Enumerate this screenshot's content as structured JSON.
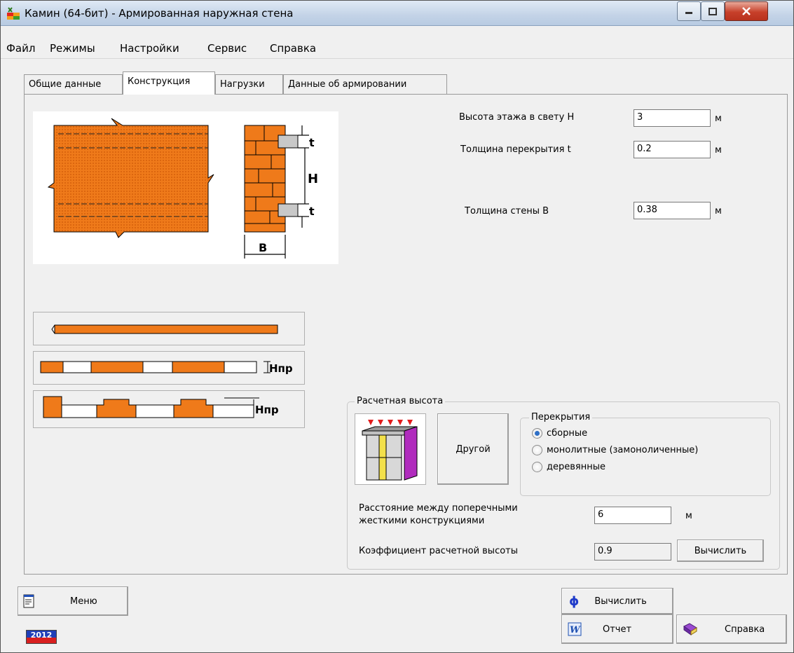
{
  "window": {
    "title": "Камин (64-бит) - Армированная наружная стена"
  },
  "menu": [
    "Файл",
    "Режимы",
    "Настройки",
    "Сервис",
    "Справка"
  ],
  "tabs": [
    "Общие данные",
    "Конструкция",
    "Нагрузки",
    "Данные об армировании"
  ],
  "active_tab": "Конструкция",
  "wall_diagram": {
    "dim_t": "t",
    "dim_H": "H",
    "dim_B": "B"
  },
  "wall_options": {
    "hpr_label": "Нпр"
  },
  "fields": {
    "height": {
      "label": "Высота этажа в свету Н",
      "value": "3",
      "unit": "м"
    },
    "slab": {
      "label": "Толщина перекрытия t",
      "value": "0.2",
      "unit": "м"
    },
    "wall": {
      "label": "Толщина стены В",
      "value": "0.38",
      "unit": "м"
    }
  },
  "calc_height": {
    "title": "Расчетная высота",
    "other_button": "Другой",
    "floors": {
      "title": "Перекрытия",
      "options": [
        "сборные",
        "монолитные (замоноличенные)",
        "деревянные"
      ],
      "selected": "сборные"
    },
    "distance": {
      "label_line1": "Расстояние между поперечными",
      "label_line2": "жесткими конструкциями",
      "value": "6",
      "unit": "м"
    },
    "coef": {
      "label": "Коэффициент расчетной высоты",
      "value": "0.9",
      "button": "Вычислить"
    }
  },
  "bottom": {
    "menu_button": "Меню",
    "calc_button": "Вычислить",
    "report_button": "Отчет",
    "help_button": "Справка",
    "year_badge": "2012"
  },
  "colors": {
    "brick": "#ef7a1a",
    "accent": "#2e6fc6"
  }
}
